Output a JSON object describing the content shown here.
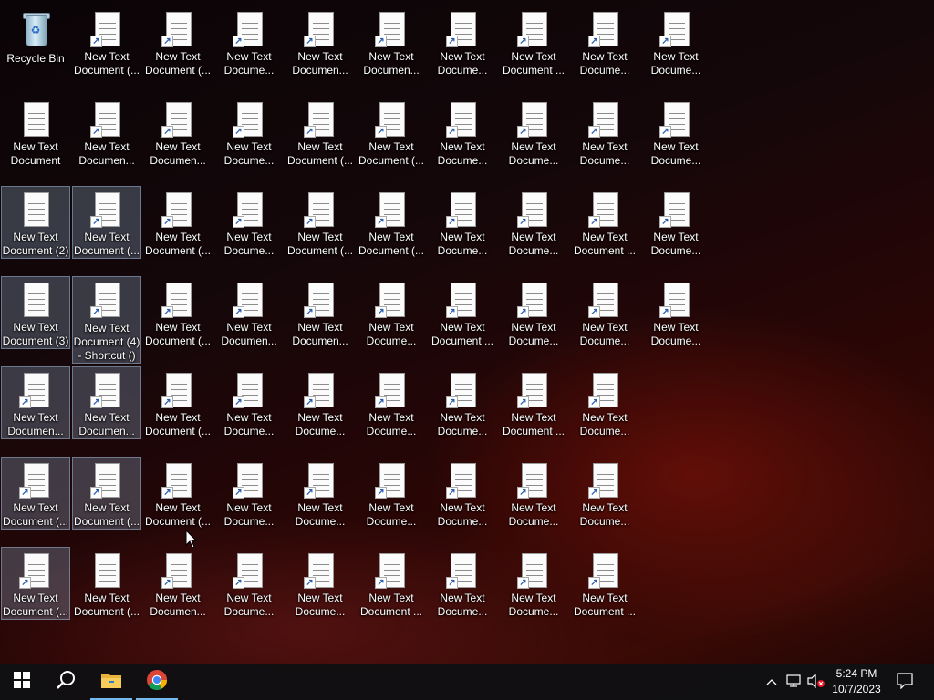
{
  "desktop": {
    "icons": [
      {
        "label": "Recycle Bin",
        "kind": "recycle",
        "selected": false
      },
      {
        "label": "New Text Document (...",
        "kind": "shortcut",
        "selected": false
      },
      {
        "label": "New Text Document (...",
        "kind": "shortcut",
        "selected": false
      },
      {
        "label": "New Text Docume...",
        "kind": "shortcut",
        "selected": false
      },
      {
        "label": "New Text Documen...",
        "kind": "shortcut",
        "selected": false
      },
      {
        "label": "New Text Documen...",
        "kind": "shortcut",
        "selected": false
      },
      {
        "label": "New Text Docume...",
        "kind": "shortcut",
        "selected": false
      },
      {
        "label": "New Text Document ...",
        "kind": "shortcut",
        "selected": false
      },
      {
        "label": "New Text Docume...",
        "kind": "shortcut",
        "selected": false
      },
      {
        "label": "New Text Docume...",
        "kind": "shortcut",
        "selected": false
      },
      {
        "label": "New Text Document",
        "kind": "doc",
        "selected": false
      },
      {
        "label": "New Text Documen...",
        "kind": "shortcut",
        "selected": false
      },
      {
        "label": "New Text Documen...",
        "kind": "shortcut",
        "selected": false
      },
      {
        "label": "New Text Docume...",
        "kind": "shortcut",
        "selected": false
      },
      {
        "label": "New Text Document (...",
        "kind": "shortcut",
        "selected": false
      },
      {
        "label": "New Text Document (...",
        "kind": "shortcut",
        "selected": false
      },
      {
        "label": "New Text Docume...",
        "kind": "shortcut",
        "selected": false
      },
      {
        "label": "New Text Docume...",
        "kind": "shortcut",
        "selected": false
      },
      {
        "label": "New Text Docume...",
        "kind": "shortcut",
        "selected": false
      },
      {
        "label": "New Text Docume...",
        "kind": "shortcut",
        "selected": false
      },
      {
        "label": "New Text Document (2)",
        "kind": "doc",
        "selected": true
      },
      {
        "label": "New Text Document (...",
        "kind": "shortcut",
        "selected": true
      },
      {
        "label": "New Text Document (...",
        "kind": "shortcut",
        "selected": false
      },
      {
        "label": "New Text Docume...",
        "kind": "shortcut",
        "selected": false
      },
      {
        "label": "New Text Document (...",
        "kind": "shortcut",
        "selected": false
      },
      {
        "label": "New Text Document (...",
        "kind": "shortcut",
        "selected": false
      },
      {
        "label": "New Text Docume...",
        "kind": "shortcut",
        "selected": false
      },
      {
        "label": "New Text Docume...",
        "kind": "shortcut",
        "selected": false
      },
      {
        "label": "New Text Document ...",
        "kind": "shortcut",
        "selected": false
      },
      {
        "label": "New Text Docume...",
        "kind": "shortcut",
        "selected": false
      },
      {
        "label": "New Text Document (3)",
        "kind": "doc",
        "selected": true
      },
      {
        "label": "New Text Document (4) - Shortcut ()",
        "kind": "shortcut",
        "selected": true
      },
      {
        "label": "New Text Document (...",
        "kind": "shortcut",
        "selected": false
      },
      {
        "label": "New Text Documen...",
        "kind": "shortcut",
        "selected": false
      },
      {
        "label": "New Text Documen...",
        "kind": "shortcut",
        "selected": false
      },
      {
        "label": "New Text Docume...",
        "kind": "shortcut",
        "selected": false
      },
      {
        "label": "New Text Document ...",
        "kind": "shortcut",
        "selected": false
      },
      {
        "label": "New Text Docume...",
        "kind": "shortcut",
        "selected": false
      },
      {
        "label": "New Text Docume...",
        "kind": "shortcut",
        "selected": false
      },
      {
        "label": "New Text Docume...",
        "kind": "shortcut",
        "selected": false
      },
      {
        "label": "New Text Documen...",
        "kind": "shortcut",
        "selected": true
      },
      {
        "label": "New Text Documen...",
        "kind": "shortcut",
        "selected": true
      },
      {
        "label": "New Text Document (...",
        "kind": "shortcut",
        "selected": false
      },
      {
        "label": "New Text Docume...",
        "kind": "shortcut",
        "selected": false
      },
      {
        "label": "New Text Docume...",
        "kind": "shortcut",
        "selected": false
      },
      {
        "label": "New Text Docume...",
        "kind": "shortcut",
        "selected": false
      },
      {
        "label": "New Text Docume...",
        "kind": "shortcut",
        "selected": false
      },
      {
        "label": "New Text Document ...",
        "kind": "shortcut",
        "selected": false
      },
      {
        "label": "New Text Docume...",
        "kind": "shortcut",
        "selected": false
      },
      {
        "label": "New Text Document (...",
        "kind": "shortcut",
        "selected": true
      },
      {
        "label": "New Text Document (...",
        "kind": "shortcut",
        "selected": true
      },
      {
        "label": "New Text Document (...",
        "kind": "shortcut",
        "selected": false
      },
      {
        "label": "New Text Docume...",
        "kind": "shortcut",
        "selected": false
      },
      {
        "label": "New Text Docume...",
        "kind": "shortcut",
        "selected": false
      },
      {
        "label": "New Text Docume...",
        "kind": "shortcut",
        "selected": false
      },
      {
        "label": "New Text Docume...",
        "kind": "shortcut",
        "selected": false
      },
      {
        "label": "New Text Docume...",
        "kind": "shortcut",
        "selected": false
      },
      {
        "label": "New Text Docume...",
        "kind": "shortcut",
        "selected": false
      },
      {
        "label": "New Text Document (...",
        "kind": "shortcut",
        "selected": true
      },
      {
        "label": "New Text Document (...",
        "kind": "doc",
        "selected": false
      },
      {
        "label": "New Text Documen...",
        "kind": "shortcut",
        "selected": false
      },
      {
        "label": "New Text Docume...",
        "kind": "shortcut",
        "selected": false
      },
      {
        "label": "New Text Docume...",
        "kind": "shortcut",
        "selected": false
      },
      {
        "label": "New Text Document ...",
        "kind": "shortcut",
        "selected": false
      },
      {
        "label": "New Text Docume...",
        "kind": "shortcut",
        "selected": false
      },
      {
        "label": "New Text Docume...",
        "kind": "shortcut",
        "selected": false
      },
      {
        "label": "New Text Document ...",
        "kind": "shortcut",
        "selected": false
      }
    ]
  },
  "taskbar": {
    "start_icon": "windows-logo-icon",
    "search_icon": "search-icon",
    "pinned": [
      {
        "name": "file-explorer",
        "icon": "folder-icon"
      },
      {
        "name": "chrome",
        "icon": "chrome-icon"
      }
    ],
    "tray": {
      "chevron_icon": "chevron-up-icon",
      "network_icon": "network-icon",
      "volume_icon": "volume-muted-icon",
      "notification_icon": "notification-icon"
    },
    "clock": {
      "time": "5:24 PM",
      "date": "10/7/2023"
    }
  },
  "colors": {
    "taskbar_bg": "#101012",
    "selection": "#96b4d2",
    "shortcut_arrow": "#2a5fb0"
  }
}
